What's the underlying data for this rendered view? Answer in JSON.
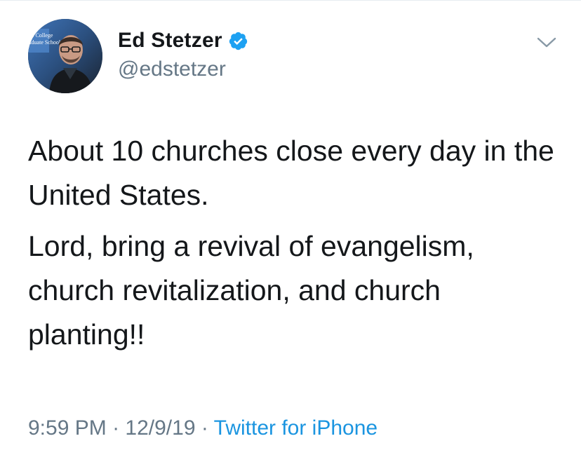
{
  "tweet": {
    "author": {
      "display_name": "Ed Stetzer",
      "handle": "@edstetzer",
      "verified": true,
      "avatar_text": [
        "he College",
        "aduate School"
      ]
    },
    "menu_icon": "chevron-down-icon",
    "text": {
      "paragraphs": [
        "About 10 churches close every day in the United States.",
        "Lord, bring a revival of evangelism, church revitalization, and church planting!!"
      ]
    },
    "meta": {
      "time": "9:59 PM",
      "separator": "·",
      "date": "12/9/19",
      "source": "Twitter for iPhone"
    }
  },
  "colors": {
    "text": "#14171a",
    "secondary": "#657786",
    "link": "#1b95e0",
    "verified": "#1da1f2"
  }
}
